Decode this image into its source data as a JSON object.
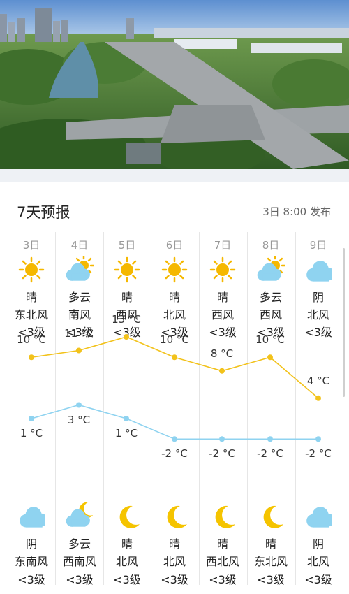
{
  "forecast": {
    "title": "7天预报",
    "published": "3日 8:00 发布"
  },
  "days": [
    {
      "date": "3日",
      "day_icon": "sun-icon",
      "day_weather": "晴",
      "day_wind": "东北风",
      "day_level": "<3级",
      "high": "10 °C",
      "low": "1 °C",
      "night_icon": "cloud-icon",
      "night_weather": "阴",
      "night_wind": "东南风",
      "night_level": "<3级"
    },
    {
      "date": "4日",
      "day_icon": "partly-cloudy-day-icon",
      "day_weather": "多云",
      "day_wind": "南风",
      "day_level": "<3级",
      "high": "11 °C",
      "low": "3 °C",
      "night_icon": "partly-cloudy-night-icon",
      "night_weather": "多云",
      "night_wind": "西南风",
      "night_level": "<3级"
    },
    {
      "date": "5日",
      "day_icon": "sun-icon",
      "day_weather": "晴",
      "day_wind": "西风",
      "day_level": "<3级",
      "high": "13 °C",
      "low": "1 °C",
      "night_icon": "moon-icon",
      "night_weather": "晴",
      "night_wind": "北风",
      "night_level": "<3级"
    },
    {
      "date": "6日",
      "day_icon": "sun-icon",
      "day_weather": "晴",
      "day_wind": "北风",
      "day_level": "<3级",
      "high": "10 °C",
      "low": "-2 °C",
      "night_icon": "moon-icon",
      "night_weather": "晴",
      "night_wind": "北风",
      "night_level": "<3级"
    },
    {
      "date": "7日",
      "day_icon": "sun-icon",
      "day_weather": "晴",
      "day_wind": "西风",
      "day_level": "<3级",
      "high": "8 °C",
      "low": "-2 °C",
      "night_icon": "moon-icon",
      "night_weather": "晴",
      "night_wind": "西北风",
      "night_level": "<3级"
    },
    {
      "date": "8日",
      "day_icon": "partly-cloudy-day-icon",
      "day_weather": "多云",
      "day_wind": "西风",
      "day_level": "<3级",
      "high": "10 °C",
      "low": "-2 °C",
      "night_icon": "moon-icon",
      "night_weather": "晴",
      "night_wind": "东北风",
      "night_level": "<3级"
    },
    {
      "date": "9日",
      "day_icon": "cloud-icon",
      "day_weather": "阴",
      "day_wind": "北风",
      "day_level": "<3级",
      "high": "4 °C",
      "low": "-2 °C",
      "night_icon": "cloud-icon",
      "night_weather": "阴",
      "night_wind": "北风",
      "night_level": "<3级"
    }
  ],
  "chart_data": {
    "type": "line",
    "x": [
      "3日",
      "4日",
      "5日",
      "6日",
      "7日",
      "8日",
      "9日"
    ],
    "series": [
      {
        "values": [
          10,
          11,
          13,
          10,
          8,
          10,
          4
        ],
        "color": "#f2c21b"
      },
      {
        "values": [
          1,
          3,
          1,
          -2,
          -2,
          -2,
          -2
        ],
        "color": "#8fd3f0"
      }
    ],
    "unit": "°C"
  },
  "colors": {
    "sun": "#f5b800",
    "moon": "#f5c400",
    "cloud": "#8fd3f0",
    "high_line": "#f2c21b",
    "low_line": "#8fd3f0"
  }
}
